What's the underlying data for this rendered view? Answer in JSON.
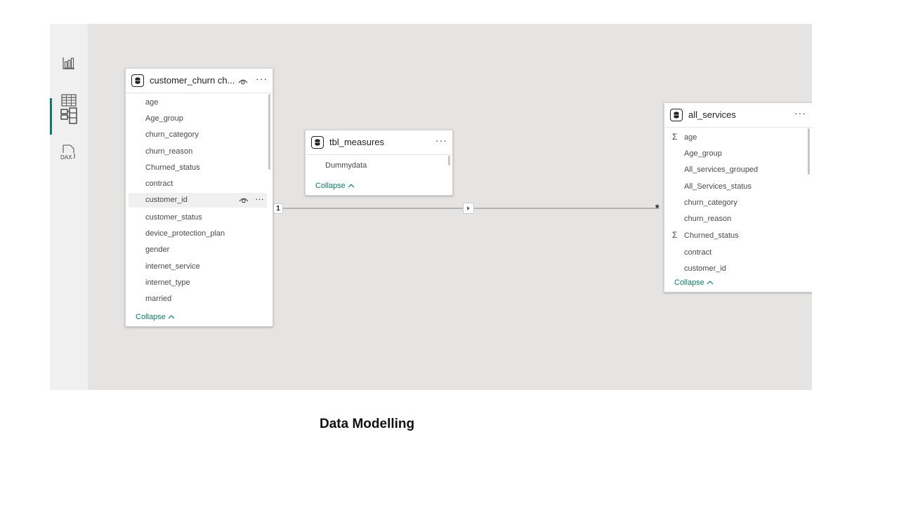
{
  "sidebar": {
    "items": [
      {
        "name": "report-view",
        "icon": "bar-chart-icon"
      },
      {
        "name": "table-view",
        "icon": "table-grid-icon"
      },
      {
        "name": "model-view",
        "icon": "model-diagram-icon",
        "active": true
      },
      {
        "name": "dax-query-view",
        "icon": "dax-icon",
        "label": "DAX"
      }
    ]
  },
  "tables": {
    "customer_churn": {
      "title": "customer_churn ch...",
      "fields": [
        "age",
        "Age_group",
        "churn_category",
        "churn_reason",
        "Churned_status",
        "contract",
        "customer_id",
        "customer_status",
        "device_protection_plan",
        "gender",
        "internet_service",
        "internet_type",
        "married"
      ],
      "collapse_label": "Collapse"
    },
    "tbl_measures": {
      "title": "tbl_measures",
      "fields": [
        "Dummydata"
      ],
      "collapse_label": "Collapse"
    },
    "all_services": {
      "title": "all_services",
      "fields": [
        "age",
        "Age_group",
        "All_services_grouped",
        "All_Services_status",
        "churn_category",
        "churn_reason",
        "Churned_status",
        "contract",
        "customer_id"
      ],
      "collapse_label": "Collapse"
    }
  },
  "relationship": {
    "from_cardinality": "1",
    "to_cardinality": "*"
  },
  "caption": "Data Modelling",
  "colors": {
    "accent": "#117865",
    "canvas": "#e5e4e3",
    "sidebar": "#f0f0f0"
  }
}
